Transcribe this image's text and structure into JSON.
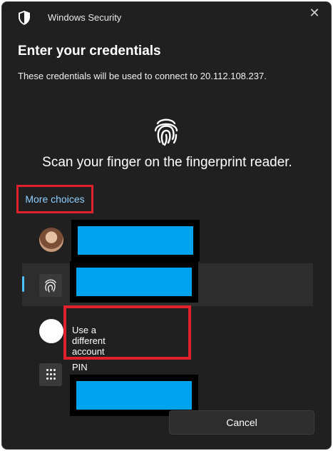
{
  "window": {
    "app_title": "Windows Security",
    "close_icon": "close-icon"
  },
  "dialog": {
    "heading": "Enter your credentials",
    "description": "These credentials will be used to connect to 20.112.108.237.",
    "scan_prompt": "Scan your finger on the fingerprint reader.",
    "more_choices_label": "More choices"
  },
  "options": {
    "different_account_label": "Use a different account",
    "pin_label": "PIN"
  },
  "footer": {
    "cancel_label": "Cancel"
  },
  "colors": {
    "window_bg": "#202020",
    "accent": "#4cc2ff",
    "link": "#8fd0ff",
    "highlight_box": "#e0202a",
    "redaction": "#00a3ee"
  }
}
